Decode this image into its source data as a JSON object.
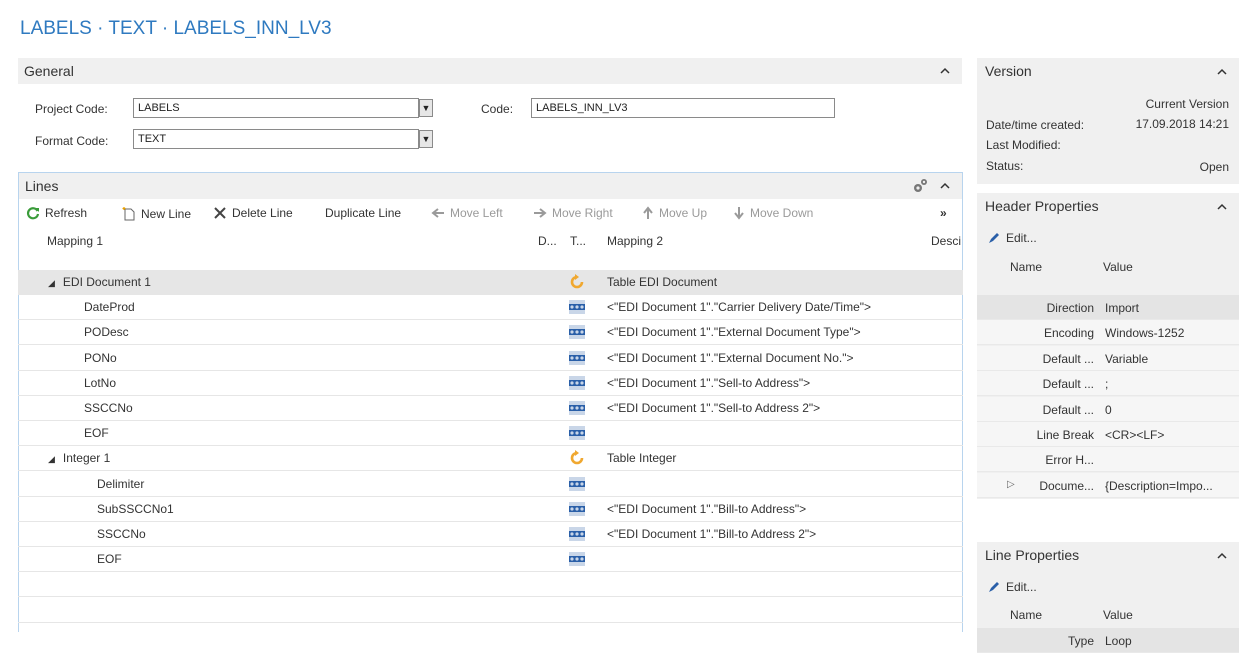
{
  "page": {
    "title": "LABELS · TEXT · LABELS_INN_LV3"
  },
  "general": {
    "title": "General",
    "project_code_label": "Project Code:",
    "project_code_value": "LABELS",
    "format_code_label": "Format Code:",
    "format_code_value": "TEXT",
    "code_label": "Code:",
    "code_value": "LABELS_INN_LV3",
    "collapse_glyph": "⌃"
  },
  "lines": {
    "title": "Lines",
    "toolbar": {
      "refresh": "Refresh",
      "new_line": "New Line",
      "delete_line": "Delete Line",
      "duplicate_line": "Duplicate Line",
      "move_left": "Move Left",
      "move_right": "Move Right",
      "move_up": "Move Up",
      "move_down": "Move Down",
      "more": "»"
    },
    "columns": {
      "mapping1": "Mapping 1",
      "d": "D...",
      "t": "T...",
      "mapping2": "Mapping 2",
      "desc": "Desci"
    },
    "rows": [
      {
        "m1": "EDI Document 1",
        "m2": "Table EDI Document"
      },
      {
        "m1": "DateProd",
        "m2": "<\"EDI Document 1\".\"Carrier Delivery Date/Time\">"
      },
      {
        "m1": "PODesc",
        "m2": "<\"EDI Document 1\".\"External Document Type\">"
      },
      {
        "m1": "PONo",
        "m2": "<\"EDI Document 1\".\"External Document No.\">"
      },
      {
        "m1": "LotNo",
        "m2": "<\"EDI Document 1\".\"Sell-to Address\">"
      },
      {
        "m1": "SSCCNo",
        "m2": "<\"EDI Document 1\".\"Sell-to Address 2\">"
      },
      {
        "m1": "EOF",
        "m2": ""
      },
      {
        "m1": "Integer 1",
        "m2": "Table Integer"
      },
      {
        "m1": "Delimiter",
        "m2": ""
      },
      {
        "m1": "SubSSCCNo1",
        "m2": "<\"EDI Document 1\".\"Bill-to Address\">"
      },
      {
        "m1": "SSCCNo",
        "m2": "<\"EDI Document 1\".\"Bill-to Address 2\">"
      },
      {
        "m1": "EOF",
        "m2": ""
      }
    ]
  },
  "version": {
    "title": "Version",
    "current_version": "Current Version",
    "created_label": "Date/time created:",
    "created_value": "17.09.2018 14:21",
    "modified_label": "Last Modified:",
    "status_label": "Status:",
    "status_value": "Open"
  },
  "header_properties": {
    "title": "Header Properties",
    "edit": "Edit...",
    "name_col": "Name",
    "value_col": "Value",
    "rows": [
      {
        "name": "Direction",
        "value": "Import"
      },
      {
        "name": "Encoding",
        "value": "Windows-1252"
      },
      {
        "name": "Default ...",
        "value": "Variable"
      },
      {
        "name": "Default ...",
        "value": ";"
      },
      {
        "name": "Default ...",
        "value": "0"
      },
      {
        "name": "Line Break",
        "value": "<CR><LF>"
      },
      {
        "name": "Error H...",
        "value": ""
      },
      {
        "name": "Docume...",
        "value": "{Description=Impo..."
      }
    ]
  },
  "line_properties": {
    "title": "Line Properties",
    "edit": "Edit...",
    "name_col": "Name",
    "value_col": "Value",
    "rows": [
      {
        "name": "Type",
        "value": "Loop"
      }
    ]
  },
  "icons": {
    "refresh": "refresh-icon",
    "new_line": "new-line-icon",
    "delete": "delete-x-icon",
    "arrow_left": "arrow-left-icon",
    "arrow_right": "arrow-right-icon",
    "arrow_up": "arrow-up-icon",
    "arrow_down": "arrow-down-icon",
    "settings": "gears-icon",
    "edit": "pencil-icon",
    "table": "table-loop-icon",
    "field": "field-dots-icon"
  },
  "colors": {
    "title": "#2f7ac0",
    "refresh": "#3a9c3a",
    "table_icon": "#f0a830",
    "field_icon": "#2a5fa8"
  }
}
